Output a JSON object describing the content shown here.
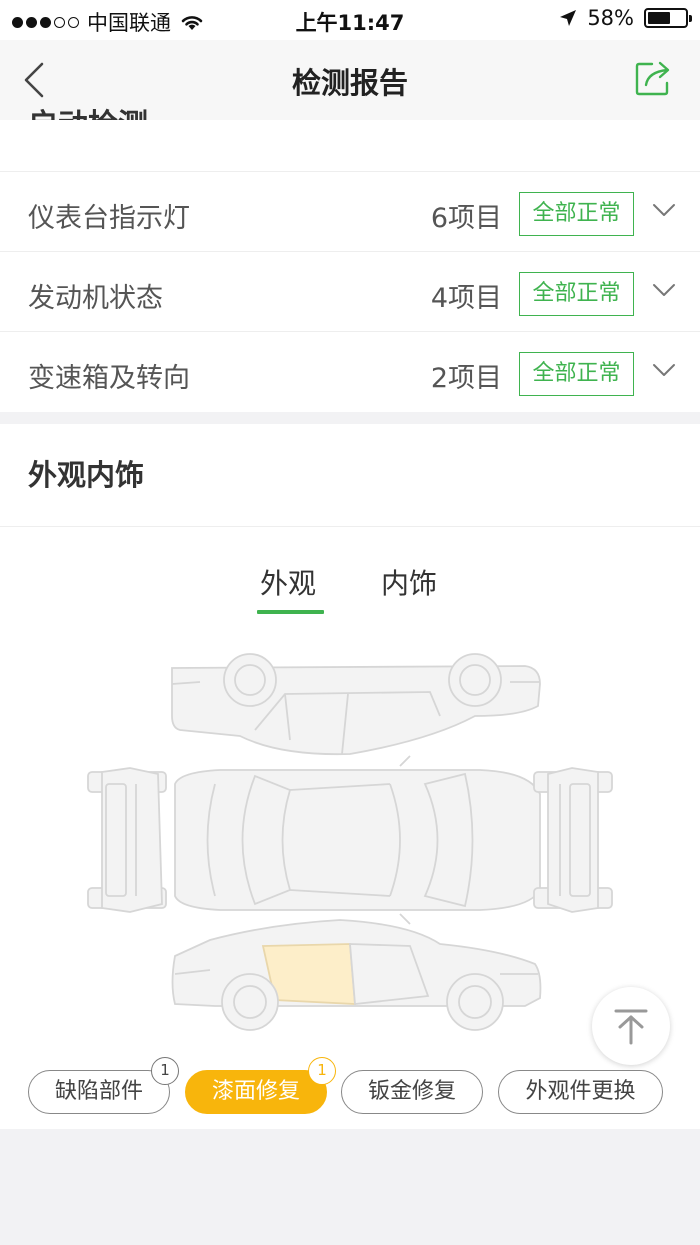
{
  "status_bar": {
    "carrier": "中国联通",
    "time": "上午11:47",
    "battery": "58%",
    "battery_level": 0.58
  },
  "nav": {
    "title": "检测报告",
    "back_icon": "chevron-left-icon",
    "share_icon": "share-icon"
  },
  "startup": {
    "heading": "启动检测",
    "rows": [
      {
        "label": "仪表台指示灯",
        "count": "6项目",
        "status": "全部正常"
      },
      {
        "label": "发动机状态",
        "count": "4项目",
        "status": "全部正常"
      },
      {
        "label": "变速箱及转向",
        "count": "2项目",
        "status": "全部正常"
      }
    ]
  },
  "exterior": {
    "heading": "外观内饰",
    "tabs": [
      {
        "label": "外观",
        "active": true
      },
      {
        "label": "内饰",
        "active": false
      }
    ],
    "chips": [
      {
        "label": "缺陷部件",
        "badge": "1",
        "active": false
      },
      {
        "label": "漆面修复",
        "badge": "1",
        "active": true
      },
      {
        "label": "钣金修复",
        "active": false
      },
      {
        "label": "外观件更换",
        "active": false
      }
    ]
  },
  "colors": {
    "accent": "#3fb34f",
    "highlight": "#f8b50c",
    "damaged_panel": "#fdeec9"
  }
}
